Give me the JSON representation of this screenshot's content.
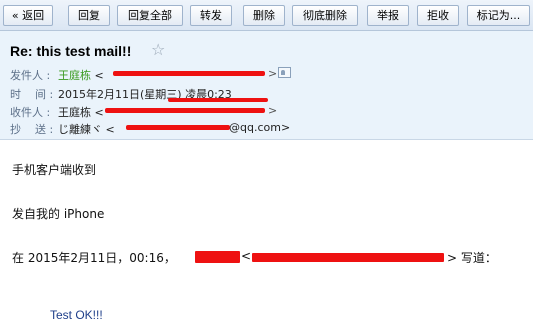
{
  "toolbar": {
    "back": "« 返回",
    "reply": "回复",
    "reply_all": "回复全部",
    "forward": "转发",
    "delete": "删除",
    "delete_permanently": "彻底删除",
    "report": "举报",
    "reject": "拒收",
    "mark_as": "标记为..."
  },
  "header": {
    "subject": "Re: this test mail!!",
    "star": "☆",
    "from_label": "发件人 :",
    "from_name": "王庭栋",
    "from_open": "<",
    "from_close": ">",
    "time_label": "时    间 :",
    "time_value": "2015年2月11日(星期三) 凌晨0:23",
    "to_label": "收件人 :",
    "to_name": "王庭栋",
    "to_open": "<",
    "to_close": ">",
    "cc_label": "抄    送 :",
    "cc_name": "じ離練ヾ",
    "cc_open": "<",
    "cc_domain": "@qq.com>"
  },
  "body": {
    "line1": "手机客户端收到",
    "line2": "发自我的 iPhone",
    "quote_prefix": "在 2015年2月11日，00:16，",
    "quote_open": "<",
    "quote_suffix": "> 写道：",
    "quoted_text": "Test OK!!!"
  },
  "colors": {
    "redaction": "#ee1111",
    "sender_name": "#3a9a1f",
    "quoted_text": "#1f3f8a"
  }
}
